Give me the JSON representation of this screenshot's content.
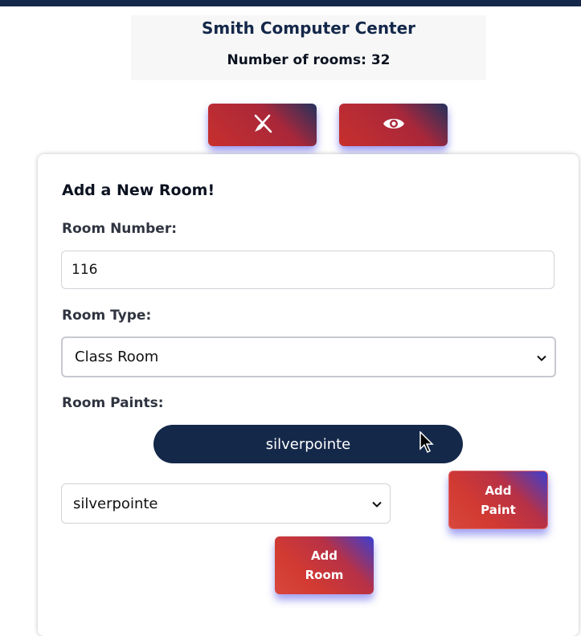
{
  "header": {
    "center_name": "Smith Computer Center",
    "rooms_count": "Number of rooms: 32"
  },
  "toolbar": {
    "clean_icon": "broom-slash-icon",
    "view_icon": "eye-icon"
  },
  "form": {
    "title": "Add a New Room!",
    "room_number": {
      "label": "Room Number:",
      "value": "116"
    },
    "room_type": {
      "label": "Room Type:",
      "selected": "Class Room"
    },
    "room_paints": {
      "label": "Room Paints:",
      "added": [
        "silverpointe"
      ],
      "select_value": "silverpointe",
      "add_button": "Add\nPaint"
    },
    "add_room_button": "Add\nRoom"
  },
  "colors": {
    "navy": "#14284a",
    "accent_red": "#c7302d",
    "accent_blue": "#3b3fd0"
  }
}
